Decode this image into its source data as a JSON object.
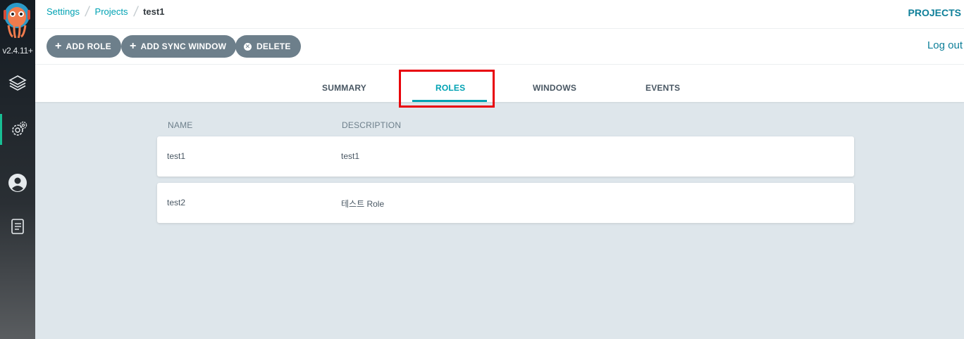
{
  "sidebar": {
    "version": "v2.4.11+",
    "items": [
      {
        "name": "applications",
        "icon": "layers-icon"
      },
      {
        "name": "settings",
        "icon": "gear-icon",
        "active": true
      },
      {
        "name": "user-info",
        "icon": "user-circle-icon"
      },
      {
        "name": "documentation",
        "icon": "book-icon"
      }
    ]
  },
  "breadcrumb": {
    "items": [
      "Settings",
      "Projects"
    ],
    "current": "test1"
  },
  "header": {
    "projects_label": "PROJECTS",
    "logout_label": "Log out"
  },
  "actions": {
    "add_role": "ADD ROLE",
    "add_sync_window": "ADD SYNC WINDOW",
    "delete": "DELETE"
  },
  "tabs": [
    {
      "label": "SUMMARY"
    },
    {
      "label": "ROLES",
      "active": true
    },
    {
      "label": "WINDOWS"
    },
    {
      "label": "EVENTS"
    }
  ],
  "roles_table": {
    "headers": [
      "NAME",
      "DESCRIPTION"
    ],
    "rows": [
      {
        "name": "test1",
        "description": "test1"
      },
      {
        "name": "test2",
        "description": "테스트 Role"
      }
    ]
  },
  "colors": {
    "accent": "#00a2b3",
    "button": "#6d7f8b",
    "highlight": "#e8000a",
    "background": "#dee6eb"
  }
}
